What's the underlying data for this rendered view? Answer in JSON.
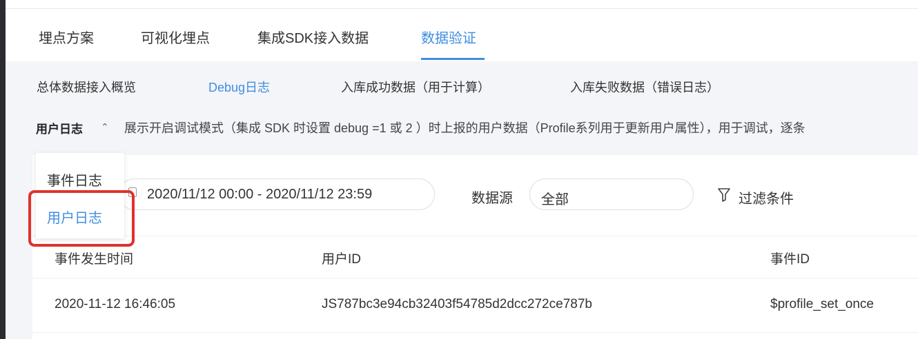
{
  "top_tabs": [
    {
      "label": "埋点方案"
    },
    {
      "label": "可视化埋点"
    },
    {
      "label": "集成SDK接入数据"
    },
    {
      "label": "数据验证",
      "active": true
    }
  ],
  "sub_tabs": [
    {
      "label": "总体数据接入概览"
    },
    {
      "label": "Debug日志",
      "active": true
    },
    {
      "label": "入库成功数据（用于计算）"
    },
    {
      "label": "入库失败数据（错误日志）"
    }
  ],
  "log_type": {
    "selected": "用户日志",
    "description": "展示开启调试模式（集成 SDK 时设置 debug =1 或 2 ）时上报的用户数据（Profile系列用于更新用户属性），用于调试，逐条"
  },
  "dropdown": {
    "options": [
      {
        "label": "事件日志"
      },
      {
        "label": "用户日志",
        "selected": true
      }
    ]
  },
  "filters": {
    "date_range": "2020/11/12 00:00 - 2020/11/12 23:59",
    "source_label": "数据源",
    "source_value": "全部",
    "filter_label": "过滤条件"
  },
  "table": {
    "columns": [
      "事件发生时间",
      "用户ID",
      "事件ID"
    ],
    "rows": [
      [
        "2020-11-12 16:46:05",
        "JS787bc3e94cb32403f54785d2dcc272ce787b",
        "$profile_set_once"
      ]
    ]
  },
  "colors": {
    "accent": "#3f8ee0",
    "highlight": "#e0312b"
  },
  "icons": {
    "date": "calendar-icon",
    "filter": "funnel-icon",
    "expand": "chevron-up-icon"
  }
}
